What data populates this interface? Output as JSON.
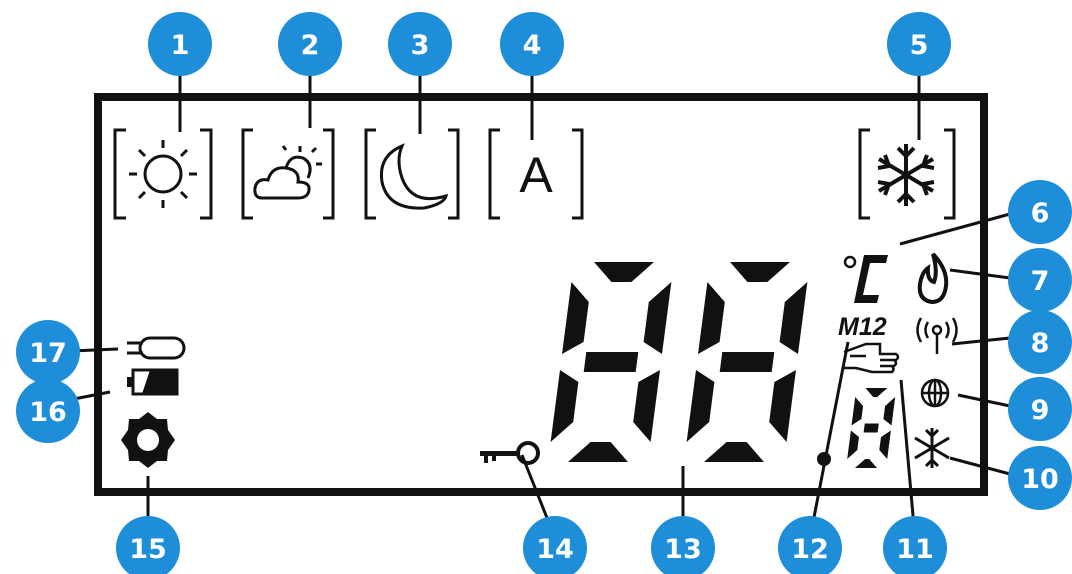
{
  "colors": {
    "callout": "#1E8ED9",
    "ink": "#111111",
    "frame": "#111111",
    "background": "#ffffff"
  },
  "display": {
    "mode_icons": [
      {
        "number": "1",
        "icon": "sun-icon"
      },
      {
        "number": "2",
        "icon": "partly-cloudy-icon"
      },
      {
        "number": "3",
        "icon": "moon-icon"
      },
      {
        "number": "4",
        "icon": "auto-mode-icon",
        "letter": "A"
      },
      {
        "number": "5",
        "icon": "snowflake-icon"
      }
    ],
    "temperature_digits": "88",
    "decimal_digit": "8",
    "unit": "°C",
    "menu_label": "M12"
  },
  "callouts": [
    {
      "number": "1",
      "target": "sun-icon"
    },
    {
      "number": "2",
      "target": "partly-cloudy-icon"
    },
    {
      "number": "3",
      "target": "moon-icon"
    },
    {
      "number": "4",
      "target": "auto-mode-icon"
    },
    {
      "number": "5",
      "target": "snowflake-icon"
    },
    {
      "number": "6",
      "target": "celsius-unit"
    },
    {
      "number": "7",
      "target": "flame-icon"
    },
    {
      "number": "8",
      "target": "wireless-icon"
    },
    {
      "number": "9",
      "target": "globe-icon"
    },
    {
      "number": "10",
      "target": "frost-icon"
    },
    {
      "number": "11",
      "target": "decimal-digit"
    },
    {
      "number": "12",
      "target": "hand-icon"
    },
    {
      "number": "13",
      "target": "main-digits"
    },
    {
      "number": "14",
      "target": "key-icon"
    },
    {
      "number": "15",
      "target": "gear-icon"
    },
    {
      "number": "16",
      "target": "battery-icon"
    },
    {
      "number": "17",
      "target": "probe-icon"
    }
  ]
}
